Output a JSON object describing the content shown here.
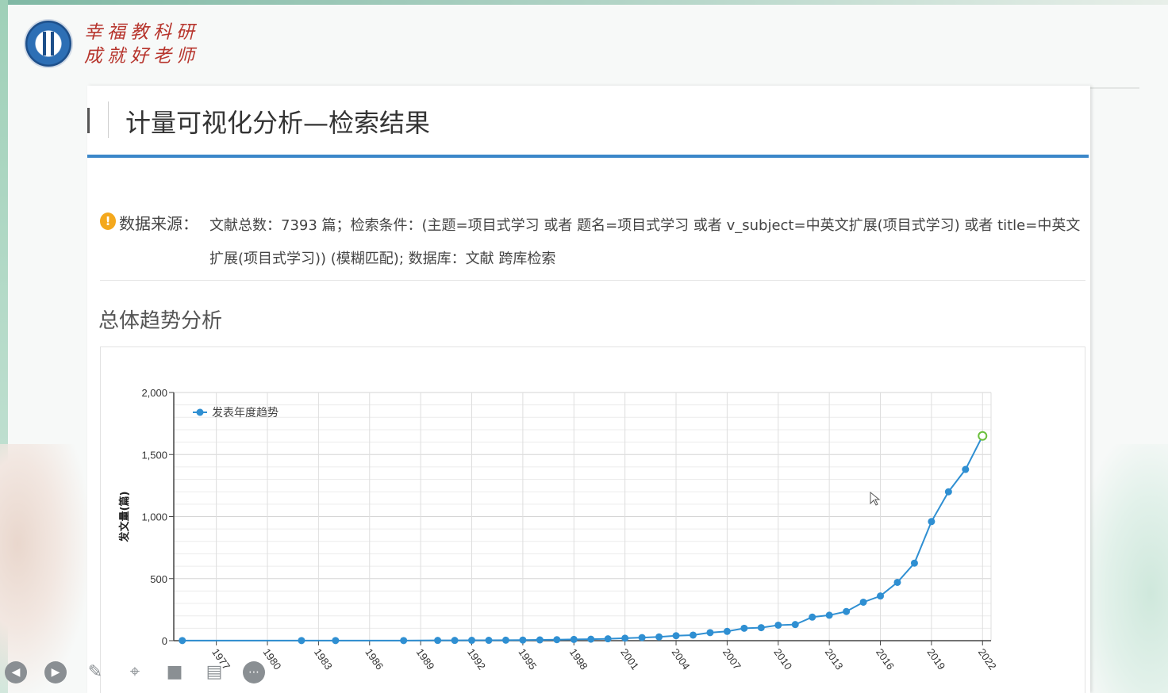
{
  "brand": {
    "slogan_line1": "幸福教科研",
    "slogan_line2": "成就好老师"
  },
  "page": {
    "title": "计量可视化分析—检索结果"
  },
  "source": {
    "label": "数据来源：",
    "text": "文献总数：7393 篇；检索条件：(主题=项目式学习 或者 题名=项目式学习 或者 v_subject=中英文扩展(项目式学习) 或者 title=中英文扩展(项目式学习)) (模糊匹配); 数据库：文献 跨库检索"
  },
  "section": {
    "title": "总体趋势分析"
  },
  "chart_data": {
    "type": "line",
    "ylabel": "发文量(篇)",
    "ylim": [
      0,
      2000
    ],
    "yticks": [
      "0",
      "500",
      "1,000",
      "1,500",
      "2,000"
    ],
    "xticks": [
      "1977",
      "1980",
      "1983",
      "1986",
      "1989",
      "1992",
      "1995",
      "1998",
      "2001",
      "2004",
      "2007",
      "2010",
      "2013",
      "2016",
      "2019",
      "2022"
    ],
    "grid": true,
    "legend_position": "top-left",
    "series": [
      {
        "name": "发表年度趋势",
        "color": "#2f8fd2",
        "x": [
          1975,
          1982,
          1984,
          1988,
          1990,
          1991,
          1992,
          1993,
          1994,
          1995,
          1996,
          1997,
          1998,
          1999,
          2000,
          2001,
          2002,
          2003,
          2004,
          2005,
          2006,
          2007,
          2008,
          2009,
          2010,
          2011,
          2012,
          2013,
          2014,
          2015,
          2016,
          2017,
          2018,
          2019,
          2020,
          2021,
          2022
        ],
        "y": [
          1,
          1,
          1,
          1,
          2,
          2,
          3,
          3,
          4,
          5,
          6,
          8,
          10,
          12,
          15,
          20,
          25,
          30,
          40,
          45,
          65,
          75,
          100,
          105,
          125,
          130,
          190,
          205,
          235,
          310,
          360,
          470,
          625,
          960,
          1200,
          1380,
          1650
        ]
      }
    ],
    "highlight_last_point_color": "#6abf3b"
  },
  "controls": {
    "prev_icon": "prev-icon",
    "play_icon": "play-icon",
    "pen_icon": "pen-icon",
    "zoom_icon": "zoom-icon",
    "camera_icon": "camera-icon",
    "subtitle_icon": "subtitle-icon",
    "more_icon": "more-icon"
  }
}
